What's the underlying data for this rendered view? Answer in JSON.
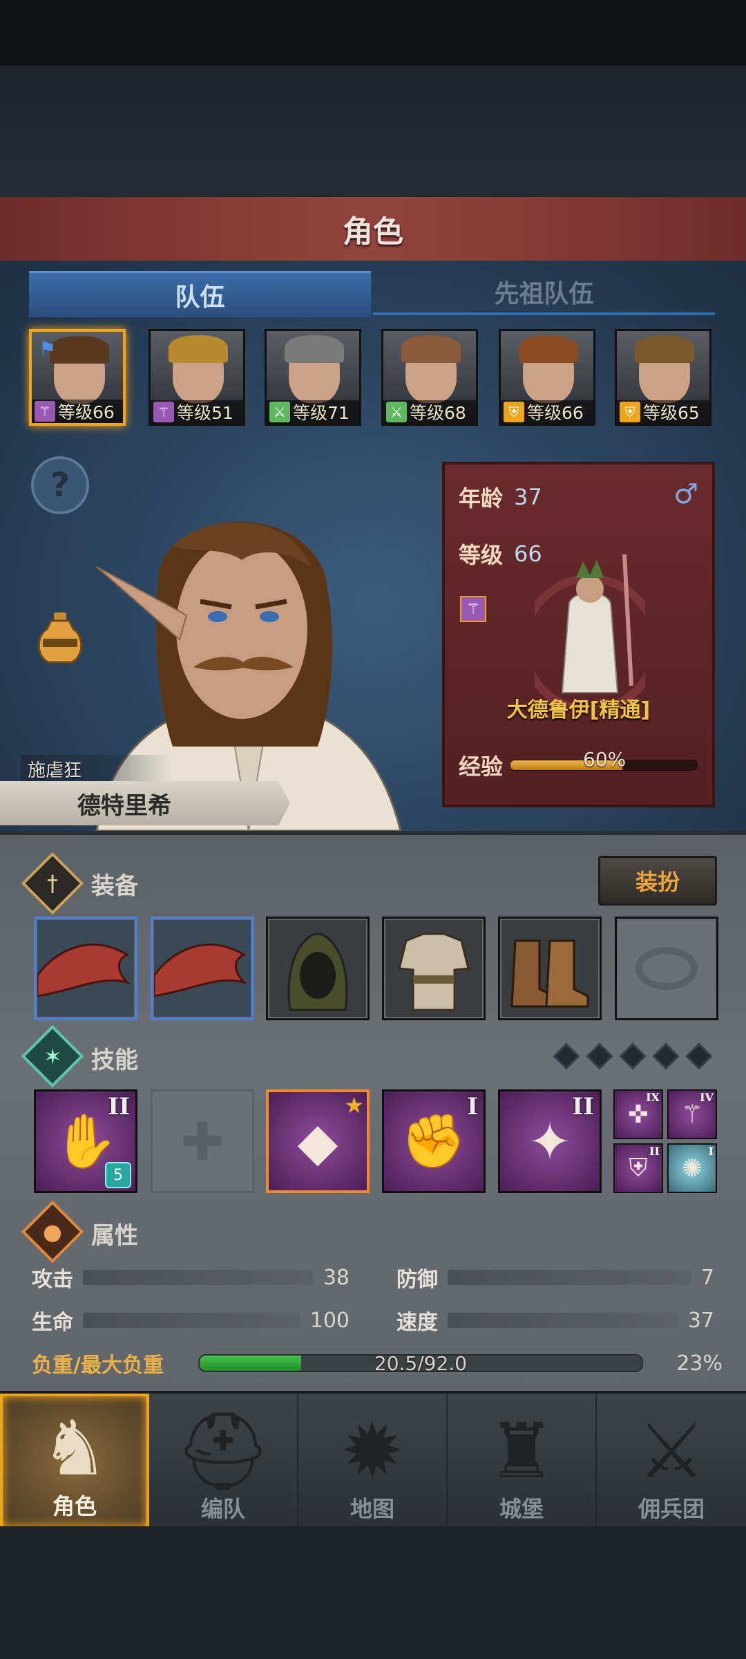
{
  "screen_title": "角色",
  "tabs": [
    {
      "label": "队伍",
      "active": true
    },
    {
      "label": "先祖队伍",
      "active": false
    }
  ],
  "team": [
    {
      "level_text": "等级66",
      "class_icon": "staff-icon",
      "class_color": "#9b59b6",
      "selected": true,
      "hair": "#5a3a1e"
    },
    {
      "level_text": "等级51",
      "class_icon": "staff-icon",
      "class_color": "#9b59b6",
      "selected": false,
      "hair": "#b88a2e"
    },
    {
      "level_text": "等级71",
      "class_icon": "crossed-swords-icon",
      "class_color": "#5fb85f",
      "selected": false,
      "hair": "#7a7a7a"
    },
    {
      "level_text": "等级68",
      "class_icon": "crossed-swords-icon",
      "class_color": "#5fb85f",
      "selected": false,
      "hair": "#8a5a3a"
    },
    {
      "level_text": "等级66",
      "class_icon": "shield-icon",
      "class_color": "#f2a31c",
      "selected": false,
      "hair": "#8a4a22"
    },
    {
      "level_text": "等级65",
      "class_icon": "shield-icon",
      "class_color": "#f2a31c",
      "selected": false,
      "hair": "#7a5a2a"
    }
  ],
  "hero": {
    "trait": "施虐狂",
    "name": "德特里希",
    "age_label": "年龄",
    "age": "37",
    "gender_icon": "male-icon",
    "level_label": "等级",
    "level": "66",
    "class_name": "大德鲁伊[精通]",
    "exp_label": "经验",
    "exp_percent_text": "60%",
    "exp_fraction": 0.6
  },
  "equipment": {
    "title": "装备",
    "dress_button": "装扮",
    "slots": [
      {
        "icon": "red-wing-weapon-icon"
      },
      {
        "icon": "red-wing-weapon-icon"
      },
      {
        "icon": "hood-icon"
      },
      {
        "icon": "tunic-icon"
      },
      {
        "icon": "boots-icon"
      },
      {
        "icon": "ring-empty-icon"
      }
    ]
  },
  "skills": {
    "title": "技能",
    "slots": [
      {
        "icon": "fire-hand-icon",
        "rank": "II",
        "badge": "5"
      },
      {
        "icon": "empty-cross-slot-icon",
        "rank": ""
      },
      {
        "icon": "crystal-tornado-icon",
        "rank": "",
        "star": true
      },
      {
        "icon": "crystal-fist-icon",
        "rank": "I"
      },
      {
        "icon": "sun-spear-icon",
        "rank": "II"
      }
    ],
    "mini": [
      {
        "icon": "radiant-cross-icon",
        "rank": "IX"
      },
      {
        "icon": "magic-staff-icon",
        "rank": "IV"
      },
      {
        "icon": "shield-emblem-icon",
        "rank": "II"
      },
      {
        "icon": "burst-icon",
        "rank": "I"
      }
    ]
  },
  "attributes": {
    "title": "属性",
    "stats": [
      {
        "label": "攻击",
        "value": "38"
      },
      {
        "label": "防御",
        "value": "7"
      },
      {
        "label": "生命",
        "value": "100"
      },
      {
        "label": "速度",
        "value": "37"
      }
    ],
    "load_label": "负重/最大负重",
    "load_text": "20.5/92.0",
    "load_percent": "23%",
    "load_fraction": 0.23
  },
  "bottom_nav": [
    {
      "label": "角色",
      "icon": "knight-icon",
      "active": true
    },
    {
      "label": "编队",
      "icon": "helmet-icon",
      "active": false
    },
    {
      "label": "地图",
      "icon": "compass-map-icon",
      "active": false
    },
    {
      "label": "城堡",
      "icon": "castle-icon",
      "active": false
    },
    {
      "label": "佣兵团",
      "icon": "mercenary-banner-icon",
      "active": false
    }
  ],
  "colors": {
    "accent_orange": "#f2a31c",
    "tab_blue": "#3b6da8",
    "card_red": "#6a2a2b",
    "load_green": "#2fa83a"
  }
}
